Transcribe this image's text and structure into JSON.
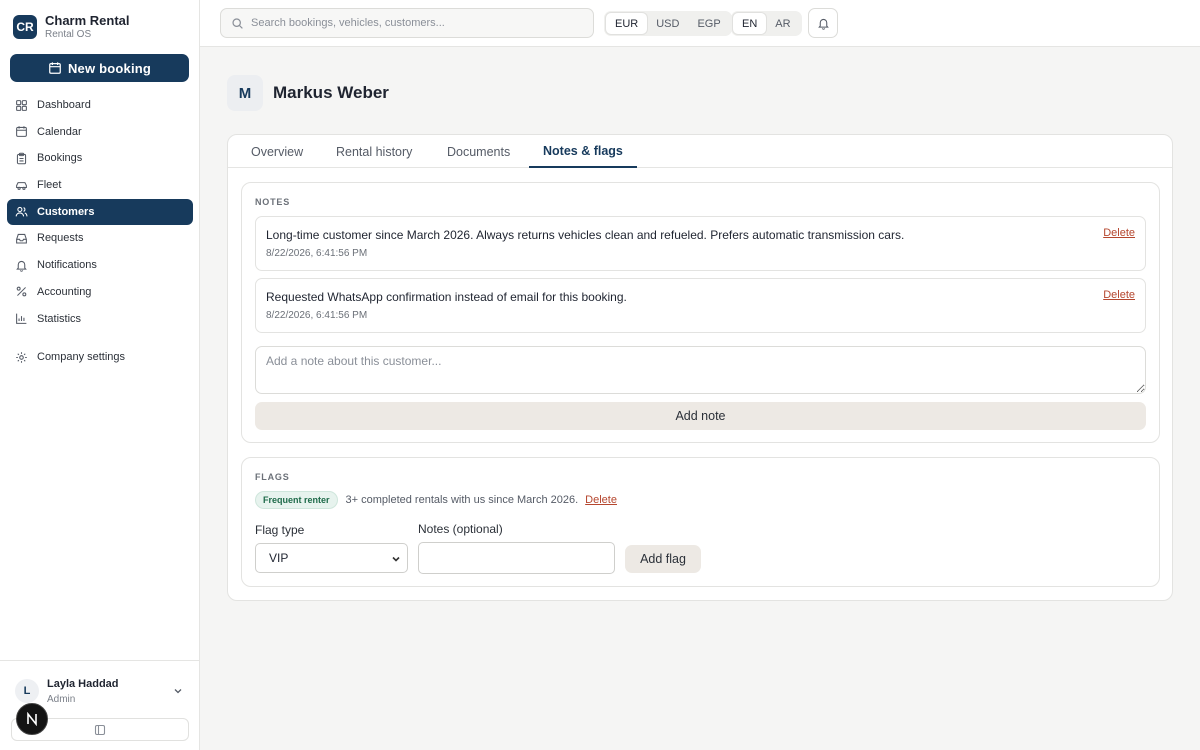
{
  "app": {
    "name": "Charm Rental",
    "subtitle": "Rental OS",
    "logo": "CR"
  },
  "sidebar": {
    "new_booking_label": "New booking",
    "items": [
      {
        "label": "Dashboard",
        "icon": "dashboard-icon"
      },
      {
        "label": "Calendar",
        "icon": "calendar-icon"
      },
      {
        "label": "Bookings",
        "icon": "clipboard-icon"
      },
      {
        "label": "Fleet",
        "icon": "car-icon"
      },
      {
        "label": "Customers",
        "icon": "users-icon",
        "active": true
      },
      {
        "label": "Requests",
        "icon": "inbox-icon"
      },
      {
        "label": "Notifications",
        "icon": "bell-icon"
      },
      {
        "label": "Accounting",
        "icon": "percent-icon"
      },
      {
        "label": "Statistics",
        "icon": "bar-chart-icon"
      }
    ],
    "settings_label": "Company settings"
  },
  "user": {
    "initial": "L",
    "name": "Layla Haddad",
    "role": "Admin"
  },
  "topbar": {
    "search_placeholder": "Search bookings, vehicles, customers...",
    "currencies": [
      "EUR",
      "USD",
      "EGP"
    ],
    "selected_currency": "EUR",
    "languages": [
      "EN",
      "AR"
    ],
    "selected_language": "EN"
  },
  "customer": {
    "initial": "M",
    "name": "Markus Weber"
  },
  "tabs": [
    "Overview",
    "Rental history",
    "Documents",
    "Notes & flags"
  ],
  "active_tab": "Notes & flags",
  "notes": {
    "section_label": "NOTES",
    "items": [
      {
        "text": "Long-time customer since March 2026. Always returns vehicles clean and refueled. Prefers automatic transmission cars.",
        "date": "8/22/2026, 6:41:56 PM",
        "delete_label": "Delete"
      },
      {
        "text": "Requested WhatsApp confirmation instead of email for this booking.",
        "date": "8/22/2026, 6:41:56 PM",
        "delete_label": "Delete"
      }
    ],
    "input_placeholder": "Add a note about this customer...",
    "add_label": "Add note"
  },
  "flags": {
    "section_label": "FLAGS",
    "items": [
      {
        "badge": "Frequent renter",
        "description": "3+ completed rentals with us since March 2026.",
        "delete_label": "Delete"
      }
    ],
    "flag_type_label": "Flag type",
    "flag_type_value": "VIP",
    "notes_label": "Notes (optional)",
    "add_label": "Add flag"
  },
  "colors": {
    "primary": "#173a5c",
    "danger": "#b5462e",
    "flag_green": "#1f6b4a"
  }
}
